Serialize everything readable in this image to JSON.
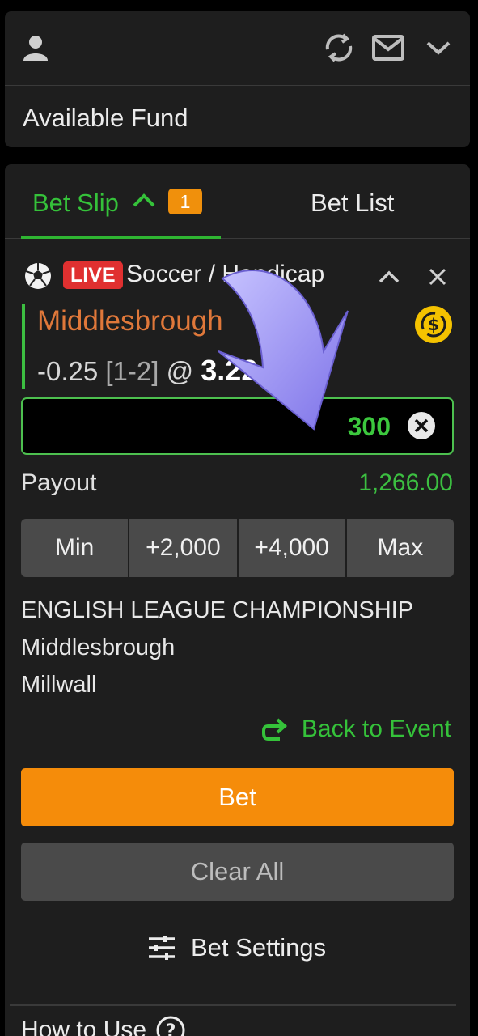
{
  "header": {
    "icons": [
      "user-icon",
      "refresh-icon",
      "mail-icon",
      "chevron-down-icon"
    ],
    "available_fund_label": "Available Fund"
  },
  "tabs": {
    "bet_slip_label": "Bet Slip",
    "bet_slip_count": "1",
    "bet_list_label": "Bet List"
  },
  "selection": {
    "live_badge": "LIVE",
    "market": "Soccer / Handicap",
    "team": "Middlesbrough",
    "line": "-0.25",
    "score": "[1-2]",
    "at": "@",
    "odds": "3.22"
  },
  "stake": {
    "value": "300"
  },
  "payout": {
    "label": "Payout",
    "value": "1,266.00"
  },
  "quick_stakes": [
    "Min",
    "+2,000",
    "+4,000",
    "Max"
  ],
  "event": {
    "league": "ENGLISH LEAGUE CHAMPIONSHIP",
    "home": "Middlesbrough",
    "away": "Millwall"
  },
  "actions": {
    "back_to_event": "Back to Event",
    "bet": "Bet",
    "clear_all": "Clear All",
    "bet_settings": "Bet Settings",
    "how_to_use": "How to Use"
  },
  "colors": {
    "accent_green": "#35c23a",
    "bet_orange": "#f58c0a",
    "live_red": "#e03030",
    "team_orange": "#e0783a"
  }
}
